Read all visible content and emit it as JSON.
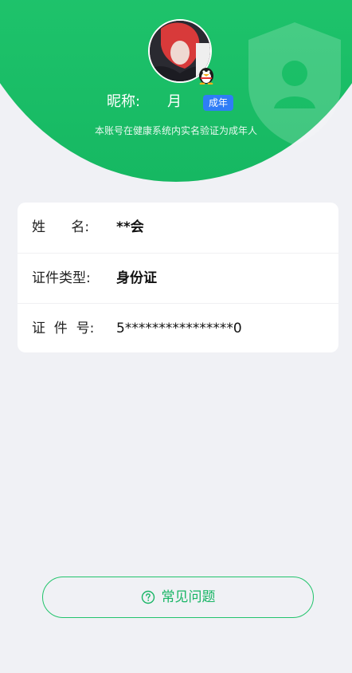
{
  "header": {
    "nickname_label": "昵称:",
    "nickname_value": "月",
    "age_badge": "成年",
    "verify_note": "本账号在健康系统内实名验证为成年人"
  },
  "info_card": {
    "rows": [
      {
        "label": "姓      名:",
        "value": "**会"
      },
      {
        "label": "证件类型:",
        "value": "身份证"
      },
      {
        "label": "证  件  号:",
        "value": "5****************0"
      }
    ]
  },
  "faq": {
    "label": "常见问题",
    "icon": "question-circle-icon"
  },
  "colors": {
    "brand_green": "#1fc46c",
    "badge_blue": "#2f7df6",
    "background": "#f0f1f5"
  }
}
